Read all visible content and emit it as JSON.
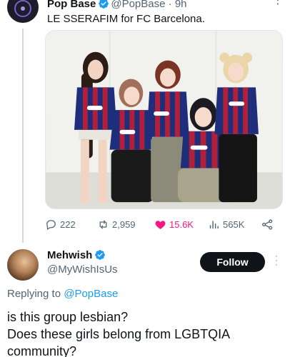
{
  "tweet": {
    "author_name": "Pop Base",
    "author_handle": "@PopBase",
    "separator": "·",
    "time": "9h",
    "text": "LE SSERAFIM for FC Barcelona.",
    "photo_text": "Spotify",
    "metrics": {
      "replies": "222",
      "retweets": "2,959",
      "likes": "15.6K",
      "views": "565K"
    }
  },
  "reply": {
    "author_name": "Mehwish",
    "author_handle": "@MyWishIsUs",
    "follow_label": "Follow",
    "replying_prefix": "Replying to",
    "replying_to": "@PopBase",
    "line1": "is this group lesbian?",
    "line2": "Does these girls belong from LGBTQIA",
    "line3": "community?"
  },
  "colors": {
    "verified": "#1d9bf0",
    "like": "#f91880",
    "muted": "#536471",
    "link": "#1d9bf0",
    "jersey_red": "#b0203a",
    "jersey_blue": "#1f2e7a"
  },
  "icons": [
    "verified-badge-icon",
    "more-icon",
    "reply-icon",
    "retweet-icon",
    "like-icon",
    "views-icon",
    "share-icon"
  ]
}
